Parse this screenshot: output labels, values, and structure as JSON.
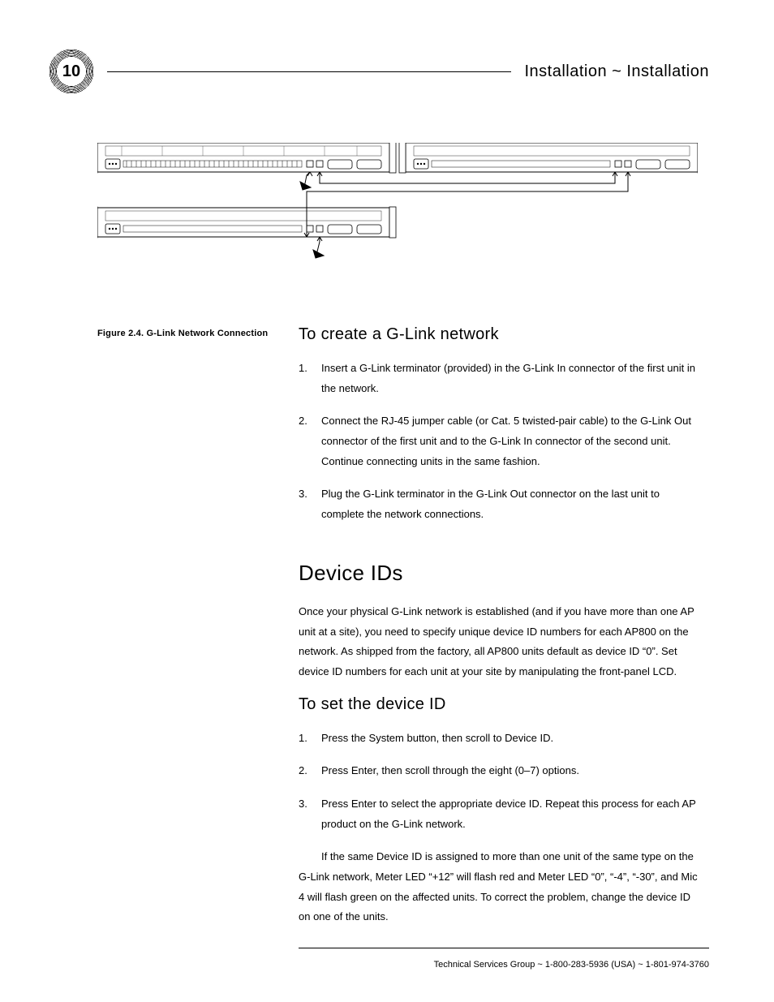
{
  "page_number": "10",
  "header": {
    "title_bold": "Installation",
    "title_sep": " ~ ",
    "title_light": "Installation"
  },
  "figure": {
    "caption": "Figure 2.4.  G-Link Network Connection"
  },
  "section_a": {
    "heading": "To create a G-Link network",
    "steps": [
      "Insert a G-Link terminator (provided) in the G-Link In connector of the first unit in the network.",
      "Connect the RJ-45 jumper cable (or Cat. 5 twisted-pair cable) to the G-Link Out connector of the first unit and to the G-Link In connector of the second unit. Continue connecting units in the same fashion.",
      "Plug the G-Link terminator in the G-Link Out connector on the last unit to complete the network connections."
    ]
  },
  "section_b": {
    "heading": "Device IDs",
    "intro": "Once your physical G-Link network is established (and if you have more than one AP unit at a site), you need to specify unique device ID numbers for each AP800 on the network. As shipped from the factory, all AP800 units default as device ID “0”. Set device ID numbers for each unit at your site by manipulating the front-panel LCD.",
    "sub_heading": "To set the device ID",
    "steps": [
      "Press the System button, then scroll to Device ID.",
      "Press Enter, then scroll through the eight (0–7) options.",
      "Press Enter to select the appropriate device ID. Repeat this process for each AP product on the G-Link network."
    ],
    "note": "If the same Device ID is assigned to more than one unit of the same type on the G-Link network, Meter LED “+12” will flash red and Meter LED “0”, “-4”, “-30”, and Mic 4 will flash green on the affected units. To correct the problem, change the device ID on one of the units."
  },
  "footer": {
    "text": "Technical Services Group ~ 1-800-283-5936 (USA) ~ 1-801-974-3760"
  }
}
